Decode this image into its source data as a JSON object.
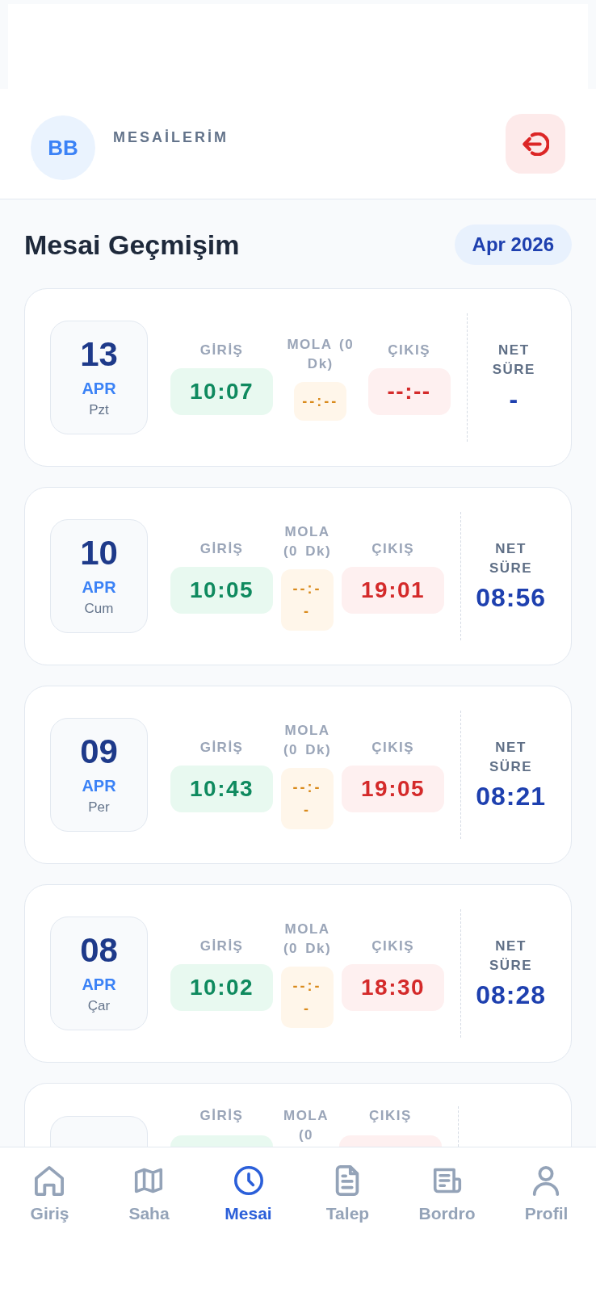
{
  "header": {
    "avatar_initials": "BB",
    "title": "MESAİLERİM"
  },
  "history": {
    "title": "Mesai Geçmişim",
    "month": "Apr 2026"
  },
  "cards": [
    {
      "kind": "full",
      "day": "13",
      "month": "APR",
      "weekday": "Pzt",
      "check_in": {
        "label": "GİRİŞ",
        "time": "10:07"
      },
      "break_period": {
        "label": "MOLA (0 Dk)",
        "time": "--:--"
      },
      "check_out": {
        "label": "ÇIKIŞ",
        "time": "--:--"
      },
      "net": {
        "label": "NET SÜRE",
        "value": "-"
      }
    },
    {
      "kind": "full",
      "day": "10",
      "month": "APR",
      "weekday": "Cum",
      "check_in": {
        "label": "GİRİŞ",
        "time": "10:05"
      },
      "break_period": {
        "label": "MOLA (0 Dk)",
        "time": "--:--"
      },
      "check_out": {
        "label": "ÇIKIŞ",
        "time": "19:01"
      },
      "net": {
        "label": "NET SÜRE",
        "value": "08:56"
      }
    },
    {
      "kind": "full",
      "day": "09",
      "month": "APR",
      "weekday": "Per",
      "check_in": {
        "label": "GİRİŞ",
        "time": "10:43"
      },
      "break_period": {
        "label": "MOLA (0 Dk)",
        "time": "--:--"
      },
      "check_out": {
        "label": "ÇIKIŞ",
        "time": "19:05"
      },
      "net": {
        "label": "NET SÜRE",
        "value": "08:21"
      }
    },
    {
      "kind": "full",
      "day": "08",
      "month": "APR",
      "weekday": "Çar",
      "check_in": {
        "label": "GİRİŞ",
        "time": "10:02"
      },
      "break_period": {
        "label": "MOLA (0 Dk)",
        "time": "--:--"
      },
      "check_out": {
        "label": "ÇIKIŞ",
        "time": "18:30"
      },
      "net": {
        "label": "NET SÜRE",
        "value": "08:28"
      }
    },
    {
      "kind": "partial",
      "check_in": {
        "label": "GİRİŞ"
      },
      "break_period": {
        "label": "MOLA (0"
      },
      "check_out": {
        "label": "ÇIKIŞ"
      }
    }
  ],
  "tabs": [
    {
      "label": "Giriş",
      "selected": false
    },
    {
      "label": "Saha",
      "selected": false
    },
    {
      "label": "Mesai",
      "selected": true
    },
    {
      "label": "Talep",
      "selected": false
    },
    {
      "label": "Bordro",
      "selected": false
    },
    {
      "label": "Profil",
      "selected": false
    }
  ]
}
